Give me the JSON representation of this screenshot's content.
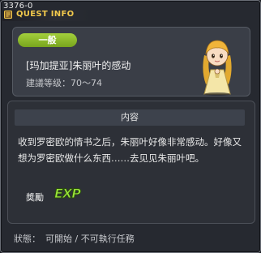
{
  "window": {
    "id_label": "3376-0",
    "title": "QUEST INFO"
  },
  "quest": {
    "category": "一般",
    "name": "[玛加提亚]朱丽叶的感动",
    "level_label": "建議等级：",
    "level_range": "70～74"
  },
  "content": {
    "header": "内容",
    "description": "收到罗密欧的情书之后，朱丽叶好像非常感动。好像又想为罗密欧做什么东西……去见见朱丽叶吧。"
  },
  "reward": {
    "label": "奬勵",
    "exp_text": "EXP"
  },
  "status": {
    "label": "狀態：",
    "text": "可開始 / 不可執行任務"
  },
  "colors": {
    "title_gold": "#f2c94c",
    "badge_green": "#8dbb2a",
    "exp_green": "#9be63a"
  },
  "icons": {
    "title": "quest-info-icon",
    "npc": "juliet-npc-portrait",
    "reward": "exp-icon"
  }
}
